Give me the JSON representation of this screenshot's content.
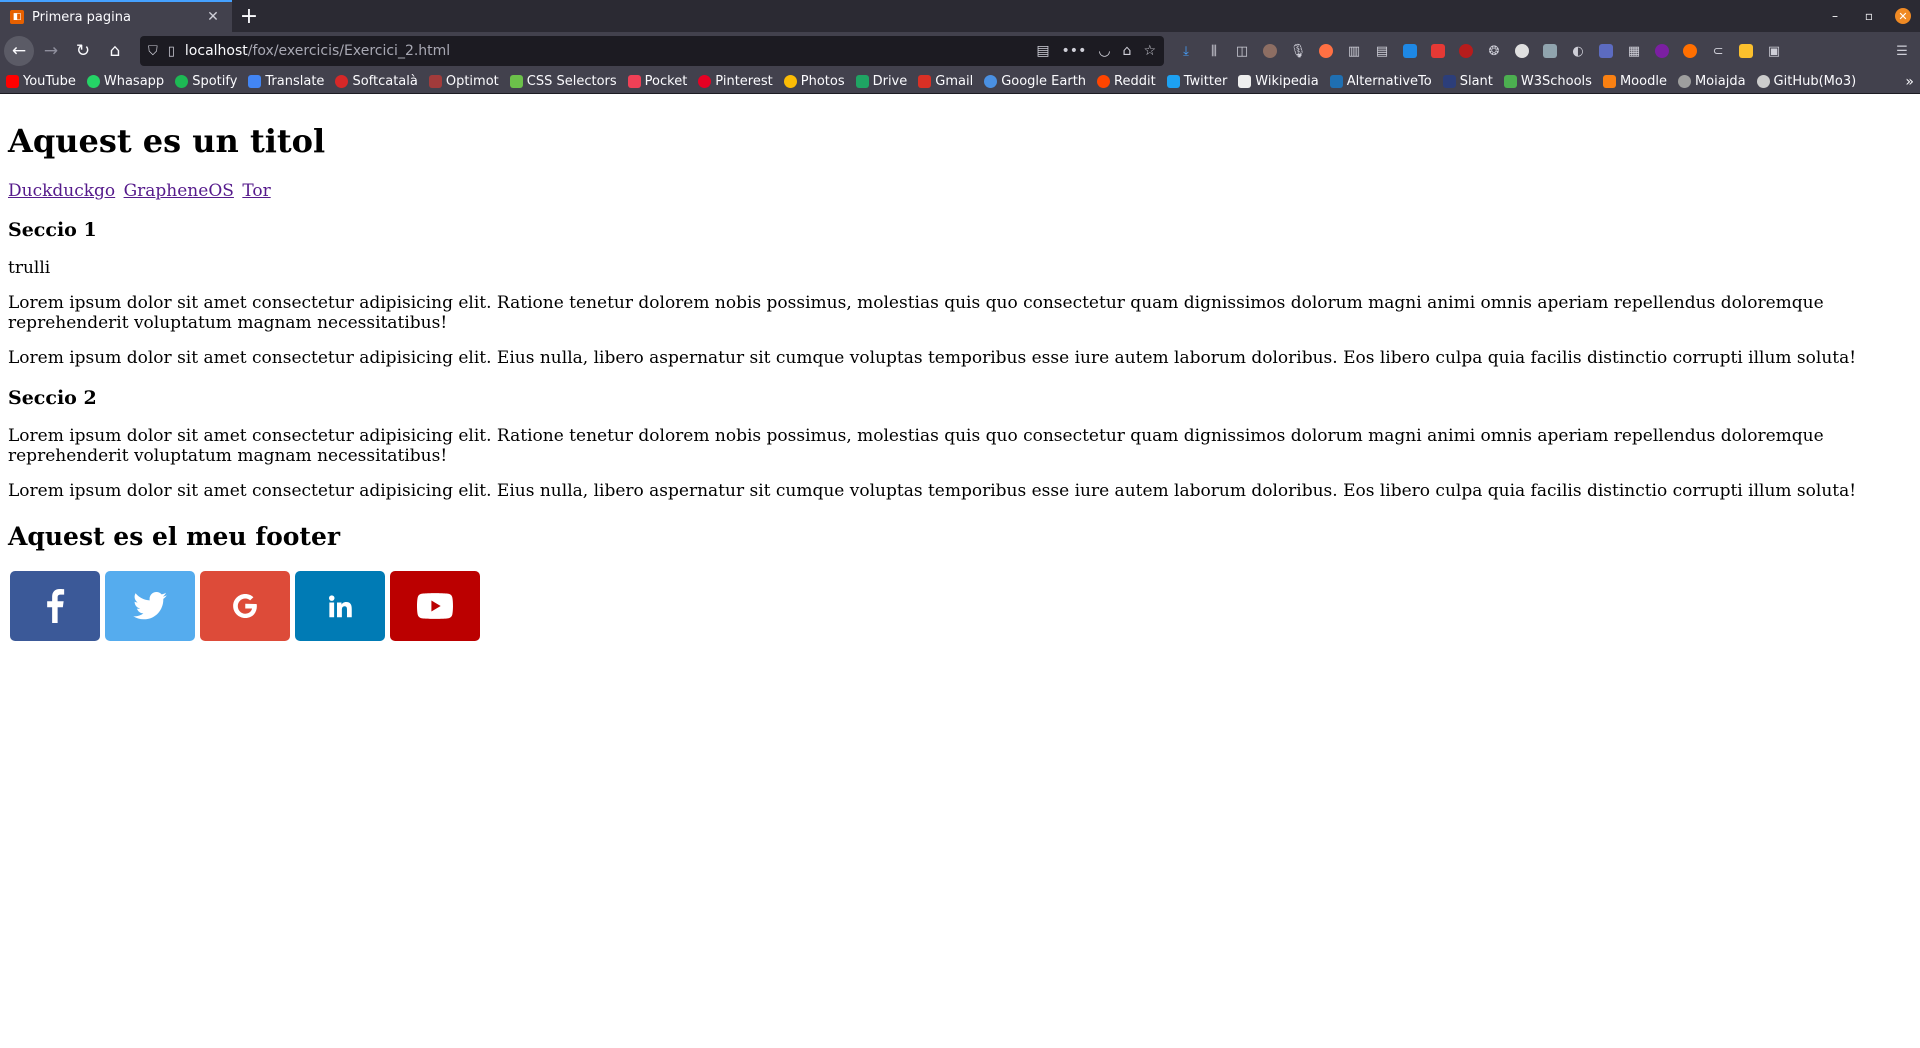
{
  "window": {
    "tab_title": "Primera pagina",
    "tab_close": "✕",
    "new_tab": "+",
    "minimize": "–",
    "maximize": "▫",
    "close": "✕"
  },
  "nav": {
    "back": "←",
    "forward": "→",
    "reload": "↻",
    "home": "⌂",
    "url_host": "localhost",
    "url_path": "/fox/exercicis/Exercici_2.html",
    "more": "•••"
  },
  "bookmarks": [
    {
      "label": "YouTube",
      "color": "#ff0000"
    },
    {
      "label": "Whasapp",
      "color": "#25d366"
    },
    {
      "label": "Spotify",
      "color": "#1db954"
    },
    {
      "label": "Translate",
      "color": "#4285f4"
    },
    {
      "label": "Softcatalà",
      "color": "#d62828"
    },
    {
      "label": "Optimot",
      "color": "#a23b3b"
    },
    {
      "label": "CSS Selectors",
      "color": "#6cc04a"
    },
    {
      "label": "Pocket",
      "color": "#ef4056"
    },
    {
      "label": "Pinterest",
      "color": "#e60023"
    },
    {
      "label": "Photos",
      "color": "#fbbc05"
    },
    {
      "label": "Drive",
      "color": "#1fa463"
    },
    {
      "label": "Gmail",
      "color": "#d93025"
    },
    {
      "label": "Google Earth",
      "color": "#4a90e2"
    },
    {
      "label": "Reddit",
      "color": "#ff4500"
    },
    {
      "label": "Twitter",
      "color": "#1da1f2"
    },
    {
      "label": "Wikipedia",
      "color": "#eeeeee"
    },
    {
      "label": "AlternativeTo",
      "color": "#1f6fb2"
    },
    {
      "label": "Slant",
      "color": "#2c3e7a"
    },
    {
      "label": "W3Schools",
      "color": "#4caf50"
    },
    {
      "label": "Moodle",
      "color": "#f98012"
    },
    {
      "label": "Moiajda",
      "color": "#9e9e9e"
    },
    {
      "label": "GitHub(Mo3)",
      "color": "#cccccc"
    }
  ],
  "page": {
    "title": "Aquest es un titol",
    "links": [
      "Duckduckgo",
      "GrapheneOS",
      "Tor"
    ],
    "section1": {
      "heading": "Seccio 1",
      "subtitle": "trulli",
      "p1": "Lorem ipsum dolor sit amet consectetur adipisicing elit. Ratione tenetur dolorem nobis possimus, molestias quis quo consectetur quam dignissimos dolorum magni animi omnis aperiam repellendus doloremque reprehenderit voluptatum magnam necessitatibus!",
      "p2": "Lorem ipsum dolor sit amet consectetur adipisicing elit. Eius nulla, libero aspernatur sit cumque voluptas temporibus esse iure autem laborum doloribus. Eos libero culpa quia facilis distinctio corrupti illum soluta!"
    },
    "section2": {
      "heading": "Seccio 2",
      "p1": "Lorem ipsum dolor sit amet consectetur adipisicing elit. Ratione tenetur dolorem nobis possimus, molestias quis quo consectetur quam dignissimos dolorum magni animi omnis aperiam repellendus doloremque reprehenderit voluptatum magnam necessitatibus!",
      "p2": "Lorem ipsum dolor sit amet consectetur adipisicing elit. Eius nulla, libero aspernatur sit cumque voluptas temporibus esse iure autem laborum doloribus. Eos libero culpa quia facilis distinctio corrupti illum soluta!"
    },
    "footer_heading": "Aquest es el meu footer",
    "social": [
      {
        "icon": "facebook-icon",
        "color": "#3b5998"
      },
      {
        "icon": "twitter-icon",
        "color": "#55acee"
      },
      {
        "icon": "google-icon",
        "color": "#dd4b39"
      },
      {
        "icon": "linkedin-icon",
        "color": "#007bb5"
      },
      {
        "icon": "youtube-icon",
        "color": "#bb0000"
      }
    ]
  }
}
